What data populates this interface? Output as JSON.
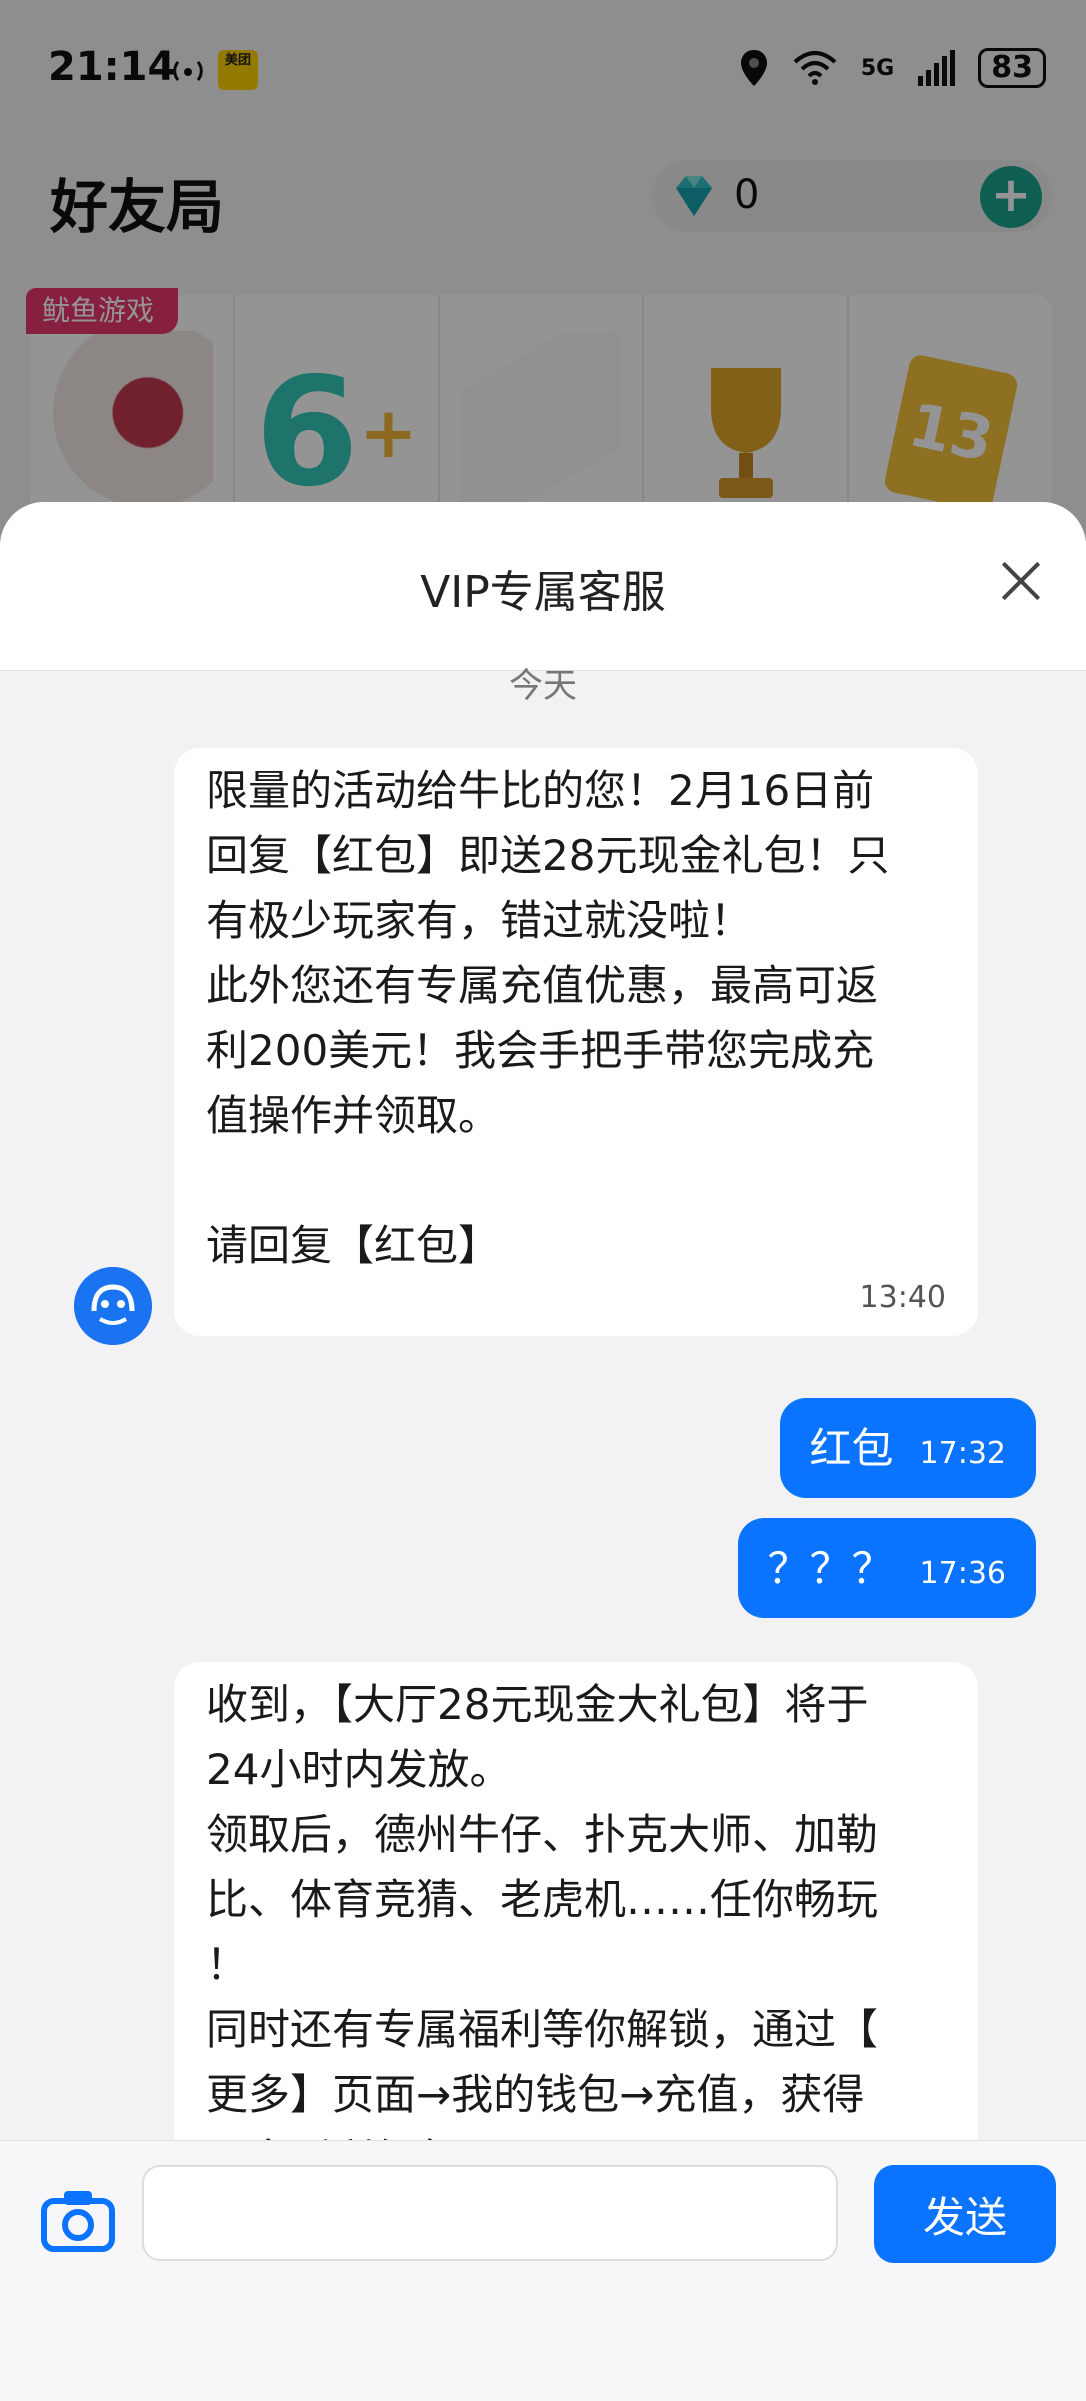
{
  "status_bar": {
    "time": "21:14",
    "meituan_label": "美团",
    "network": "5G",
    "battery": "83"
  },
  "app": {
    "title": "好友局",
    "diamond_count": "0",
    "add_icon": "plus-icon",
    "accent": "#1aa28d"
  },
  "game_strip": {
    "tag": "鱿鱼游戏",
    "tiles": [
      "poker-cards-icon",
      "six-plus-icon",
      "playing-cards-icon",
      "trophy-icon",
      "thirteen-cards-icon"
    ]
  },
  "chat": {
    "title": "VIP专属客服",
    "date_separator": "今天",
    "messages": [
      {
        "from": "agent",
        "lines": [
          "限量的活动给牛比的您！2月16日前",
          "回复【红包】即送28元现金礼包！只",
          "有极少玩家有，错过就没啦！",
          "此外您还有专属充值优惠，最高可返",
          "利200美元！我会手把手带您完成充",
          "值操作并领取。",
          "",
          "请回复【红包】"
        ],
        "time": "13:40"
      },
      {
        "from": "user",
        "text": "红包",
        "time": "17:32"
      },
      {
        "from": "user",
        "text": "？？？",
        "time": "17:36"
      },
      {
        "from": "agent",
        "lines": [
          "收到，【大厅28元现金大礼包】将于",
          "24小时内发放。",
          "领取后，德州牛仔、扑克大师、加勒",
          "比、体育竞猜、老虎机……任你畅玩",
          "！",
          "同时还有专属福利等你解锁，通过【",
          "更多】页面→我的钱包→充值，获得",
          "更多返利红包！"
        ]
      }
    ]
  },
  "input": {
    "placeholder": "",
    "send_label": "发送"
  },
  "colors": {
    "primary_blue": "#0a73ff",
    "tag_pink": "#e8386d"
  }
}
